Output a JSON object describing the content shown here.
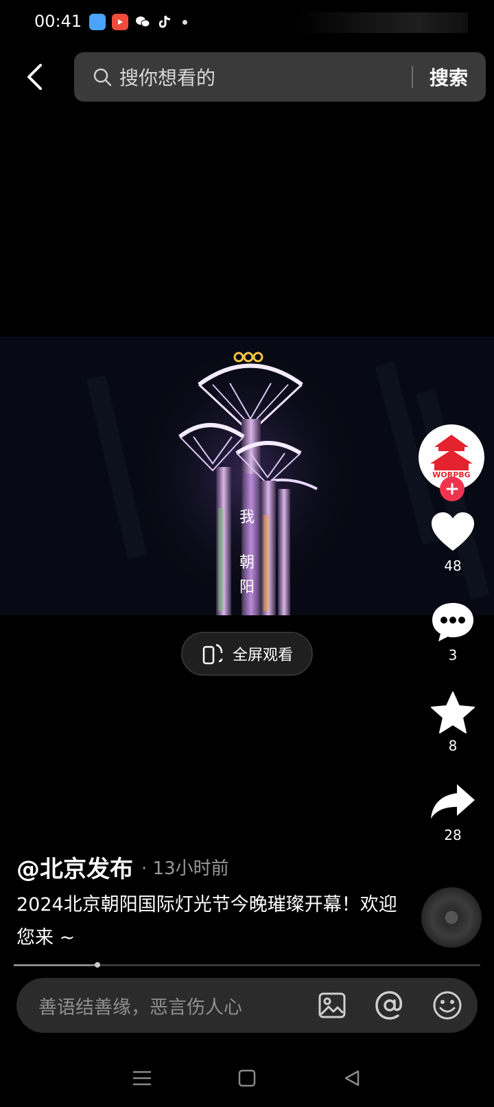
{
  "status_bar": {
    "time": "00:41",
    "apps": [
      "blue-app-icon",
      "video-app-icon",
      "wechat-icon",
      "tiktok-icon"
    ]
  },
  "search": {
    "placeholder": "搜你想看的",
    "button_label": "搜索"
  },
  "video": {
    "fullscreen_label": "全屏观看",
    "tower_text": [
      "我",
      "朝",
      "阳"
    ]
  },
  "rail": {
    "likes": "48",
    "comments": "3",
    "favorites": "8",
    "shares": "28",
    "avatar_text": "WORPBG"
  },
  "post": {
    "author": "@北京发布",
    "time": "· 13小时前",
    "caption": "2024北京朝阳国际灯光节今晚璀璨开幕！欢迎您来 ~"
  },
  "progress": {
    "fraction": 0.18
  },
  "comment": {
    "placeholder": "善语结善缘，恶言伤人心"
  },
  "colors": {
    "accent": "#f0344f",
    "search_bg": "#3a3a3a",
    "comment_bg": "#2b2b2b"
  }
}
